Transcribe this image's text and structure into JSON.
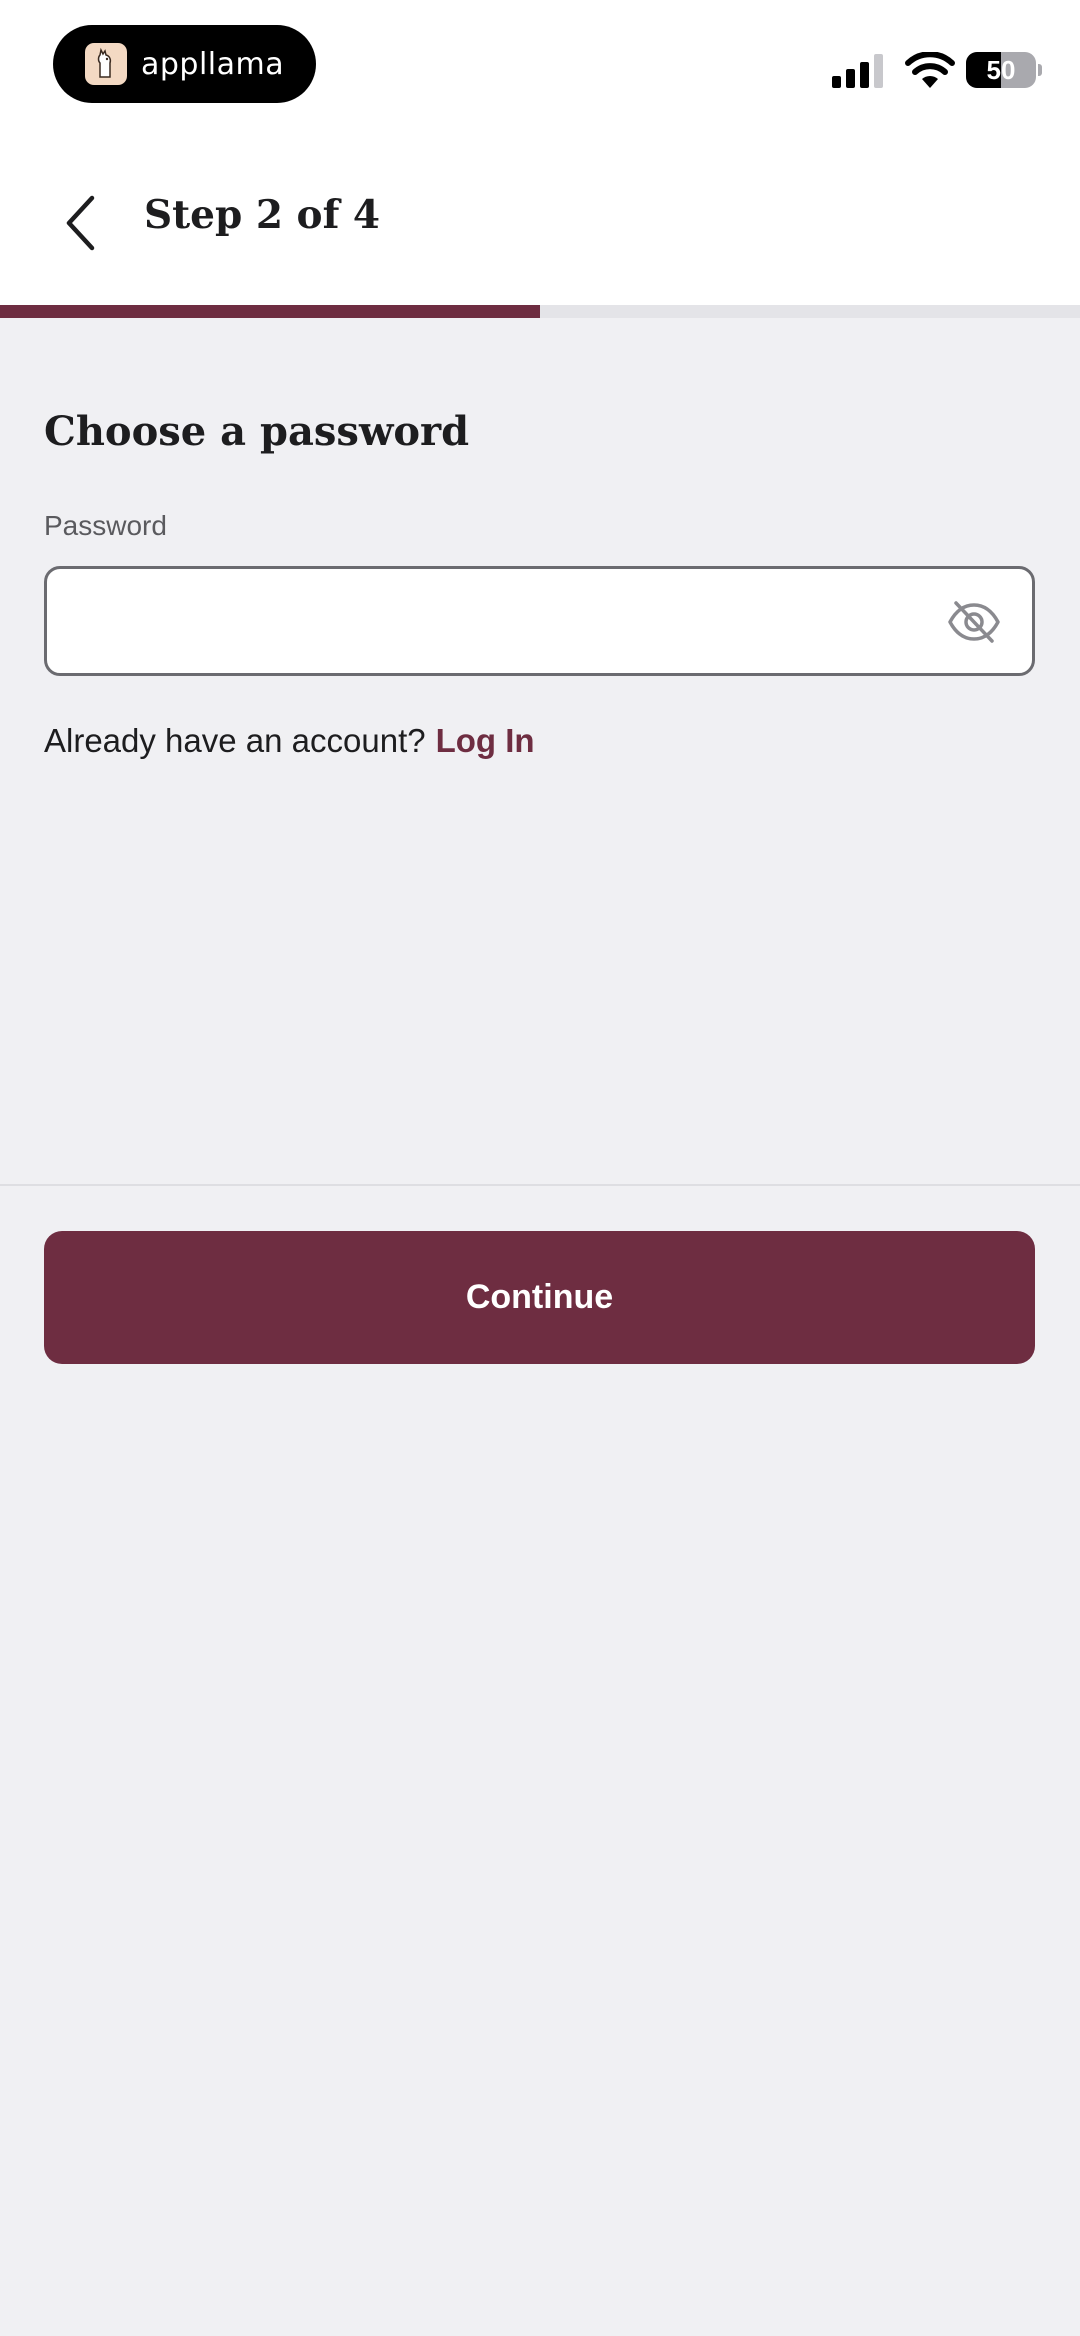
{
  "status_bar": {
    "app_name": "appllama",
    "battery_level": "50",
    "battery_fraction": 0.5
  },
  "header": {
    "back_icon": "chevron-left-icon",
    "title": "Step 2 of 4",
    "progress_fraction": 0.5
  },
  "form": {
    "heading": "Choose a password",
    "password_label": "Password",
    "password_value": "",
    "visibility_icon": "eye-off-icon",
    "login_prompt": "Already have an account?",
    "login_link": "Log In",
    "continue_label": "Continue"
  },
  "colors": {
    "accent": "#6e2d41",
    "background": "#f0f0f3",
    "surface": "#ffffff"
  }
}
